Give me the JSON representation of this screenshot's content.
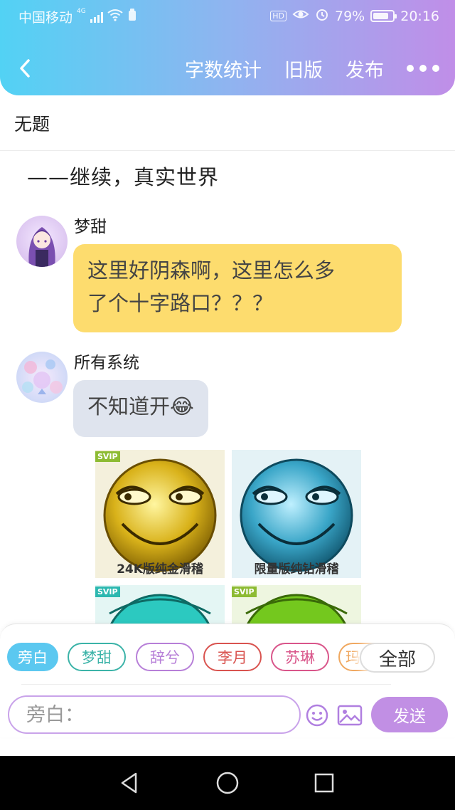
{
  "status_bar": {
    "carrier": "中国移动",
    "network": "4G",
    "hd": "HD",
    "battery": "79%",
    "battery_level": 0.79,
    "time": "20:16"
  },
  "nav": {
    "actions": [
      "字数统计",
      "旧版",
      "发布"
    ]
  },
  "document": {
    "title": "无题",
    "heading": "——继续，真实世界"
  },
  "messages": [
    {
      "sender": "梦甜",
      "text_lines": [
        "这里好阴森啊，这里怎么多",
        "了个十字路口？？？"
      ]
    },
    {
      "sender": "所有系统",
      "text": "不知道开",
      "emoji": "😂"
    }
  ],
  "stickers": [
    {
      "caption": "24K版纯金滑稽",
      "badge": "SVIP"
    },
    {
      "caption": "限量版纯钻滑稽",
      "badge": ""
    },
    {
      "caption": "",
      "badge": "SVIP"
    },
    {
      "caption": "",
      "badge": "SVIP"
    }
  ],
  "characters": {
    "chips": [
      {
        "label": "旁白",
        "color": "#5bc8f0",
        "active": true
      },
      {
        "label": "梦甜",
        "color": "#3bb3a8",
        "active": false
      },
      {
        "label": "辞兮",
        "color": "#b77fd8",
        "active": false
      },
      {
        "label": "李月",
        "color": "#d9534f",
        "active": false
      },
      {
        "label": "苏琳",
        "color": "#d9558a",
        "active": false
      },
      {
        "label": "玛",
        "color": "#f0a860",
        "active": false
      }
    ],
    "all_label": "全部"
  },
  "composer": {
    "placeholder": "旁白：",
    "send_label": "发送"
  },
  "colors": {
    "header_start": "#52d2f4",
    "header_end": "#c08ee8",
    "bubble_yellow": "#fddc6e",
    "bubble_grey": "#dfe4ee",
    "send": "#c18fe4"
  }
}
